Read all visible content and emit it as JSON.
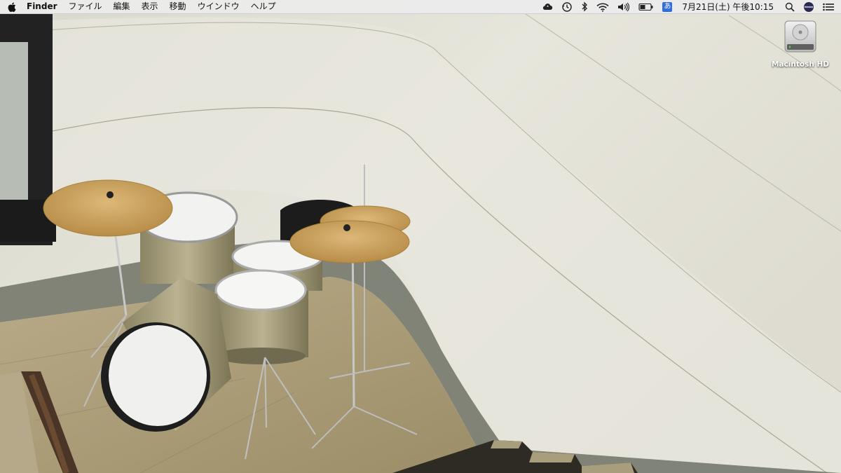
{
  "menubar": {
    "app_name": "Finder",
    "menus": [
      "ファイル",
      "編集",
      "表示",
      "移動",
      "ウインドウ",
      "ヘルプ"
    ],
    "status_icons": [
      "cloud-sync-icon",
      "time-machine-icon",
      "bluetooth-icon",
      "wifi-icon",
      "volume-icon",
      "battery-icon"
    ],
    "input_method": "あ",
    "clock": "7月21日(土) 午後10:15"
  },
  "desktop": {
    "icons": [
      {
        "label": "Macintosh HD",
        "icon": "hard-drive-icon"
      }
    ],
    "wallpaper": "drum-kit-in-stairwell-photo"
  },
  "colors": {
    "menubar_bg": "#ececec",
    "input_method_bg": "#2f6de0",
    "cymbal": "#c9a25e"
  }
}
